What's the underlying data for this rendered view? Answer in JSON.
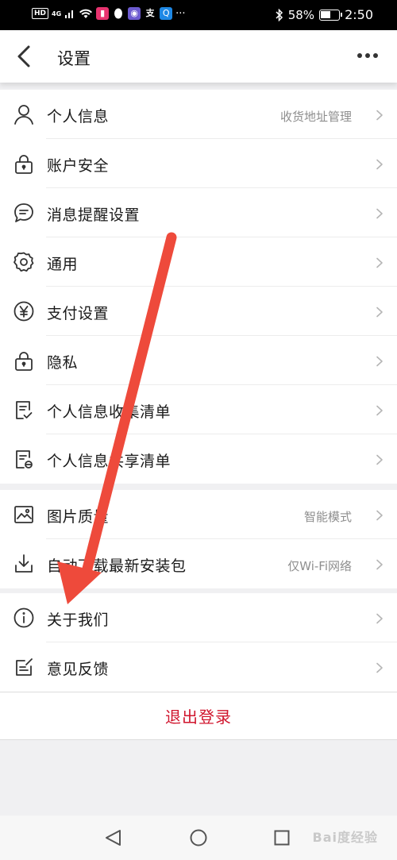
{
  "status_bar": {
    "left_badges": [
      "HD",
      "4G"
    ],
    "battery_percent": "58%",
    "battery_level": 0.58,
    "time": "2:50"
  },
  "header": {
    "title": "设置"
  },
  "groups": [
    [
      {
        "name": "personal-info",
        "label": "个人信息",
        "value": "收货地址管理",
        "icon": "person-icon"
      },
      {
        "name": "account-security",
        "label": "账户安全",
        "value": "",
        "icon": "lock-icon"
      },
      {
        "name": "message-reminder",
        "label": "消息提醒设置",
        "value": "",
        "icon": "chat-bubble-icon"
      },
      {
        "name": "general",
        "label": "通用",
        "value": "",
        "icon": "gear-icon"
      },
      {
        "name": "payment",
        "label": "支付设置",
        "value": "",
        "icon": "yuan-icon"
      },
      {
        "name": "privacy",
        "label": "隐私",
        "value": "",
        "icon": "lock-icon"
      },
      {
        "name": "info-collection-list",
        "label": "个人信息收集清单",
        "value": "",
        "icon": "checklist-icon"
      },
      {
        "name": "info-sharing-list",
        "label": "个人信息共享清单",
        "value": "",
        "icon": "share-list-icon"
      }
    ],
    [
      {
        "name": "image-quality",
        "label": "图片质量",
        "value": "智能模式",
        "icon": "image-icon"
      },
      {
        "name": "auto-download",
        "label": "自动下载最新安装包",
        "value": "仅Wi-Fi网络",
        "icon": "download-icon"
      }
    ],
    [
      {
        "name": "about-us",
        "label": "关于我们",
        "value": "",
        "icon": "info-icon"
      },
      {
        "name": "feedback",
        "label": "意见反馈",
        "value": "",
        "icon": "edit-icon"
      }
    ]
  ],
  "logout_label": "退出登录",
  "watermark": "Bai度经验",
  "colors": {
    "accent_red": "#d0152d",
    "arrow_red": "#ee4a3b",
    "icon_gray": "#333333",
    "value_gray": "#8e8e8e"
  }
}
